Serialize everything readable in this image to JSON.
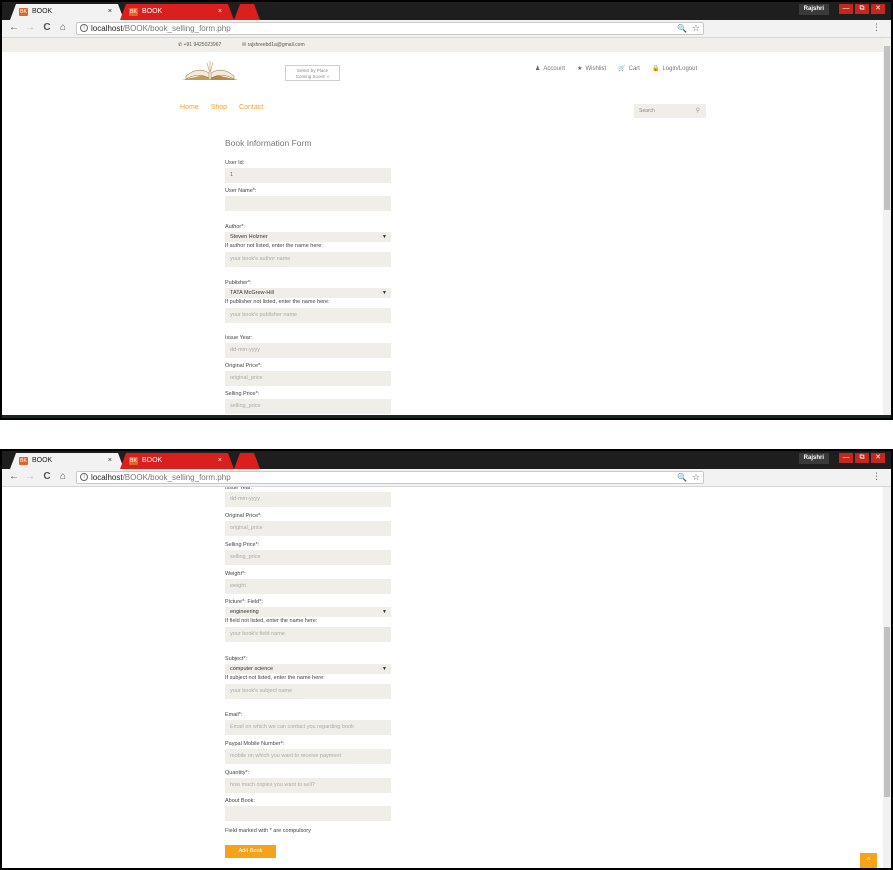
{
  "browser": {
    "tabs": [
      {
        "label": "BOOK",
        "close": "×"
      },
      {
        "label": "BOOK",
        "close": "×"
      }
    ],
    "favicon_text": "BK",
    "user": "Rajshri",
    "window_buttons": [
      "—",
      "⧉",
      "✕"
    ],
    "url_host": "localhost",
    "url_path": "/BOOK/book_selling_form.php",
    "nav_back": "←",
    "nav_forward": "→",
    "nav_reload": "C",
    "nav_home": "⌂",
    "zoom_icon": "🔍",
    "star_icon": "☆",
    "menu_icon": "⋮"
  },
  "header": {
    "phone": "✆ +91 9425023967",
    "email": "✉ rajshreebd1a@gmail.com",
    "place_btn_line1": "Select by Place",
    "place_btn_line2": "Coming Soon!! »",
    "links": [
      {
        "icon": "♟",
        "label": "Account"
      },
      {
        "icon": "★",
        "label": "Wishlist"
      },
      {
        "icon": "🛒",
        "label": "Cart"
      },
      {
        "icon": "🔒",
        "label": "Login/Logout"
      }
    ],
    "nav": [
      "Home",
      "Shop",
      "Contact"
    ],
    "search_placeholder": "Search",
    "search_icon": "⚲"
  },
  "form": {
    "title": "Book Information Form",
    "user_id_label": "User Id:",
    "user_id_value": "1",
    "user_name_label": "User Name*:",
    "author_label": "Author*:",
    "author_selected": "Steven Holzner",
    "author_hint": "If author not listed, enter the name here:",
    "author_placeholder": "your book's author name",
    "publisher_label": "Publisher*:",
    "publisher_selected": "TATA McGrew-Hill",
    "publisher_hint": "If publisher not listed, enter the name here:",
    "publisher_placeholder": "your book's publisher name",
    "issue_year_label": "Issue Year:",
    "issue_year_placeholder": "dd-mm-yyyy",
    "original_price_label": "Original Price*:",
    "original_price_placeholder": "original_price",
    "selling_price_label": "Selling Price*:",
    "selling_price_placeholder": "selling_price",
    "weight_label": "Weight*:",
    "weight_placeholder": "weight",
    "field_label": "Picture*: Field*:",
    "field_selected": "engineering",
    "field_hint": "If field not listed, enter the name here:",
    "field_placeholder": "your book's field name",
    "subject_label": "Subject*:",
    "subject_selected": "computer science",
    "subject_hint": "If subject not listed, enter the name here:",
    "subject_placeholder": "your book's subject name",
    "email_label": "Email*:",
    "email_placeholder": "Email on which we can contact you regarding book",
    "paypal_label": "Paypal Mobile Number*:",
    "paypal_placeholder": "mobile on which you want to receive payment",
    "quantity_label": "Quantity*:",
    "quantity_placeholder": "how much copies you want to sell?",
    "about_label": "About Book:",
    "compulsory_note": "Field marked with * are compulsory",
    "submit_label": "Add Book",
    "select_arrow": "▼",
    "back_to_top": "^"
  }
}
